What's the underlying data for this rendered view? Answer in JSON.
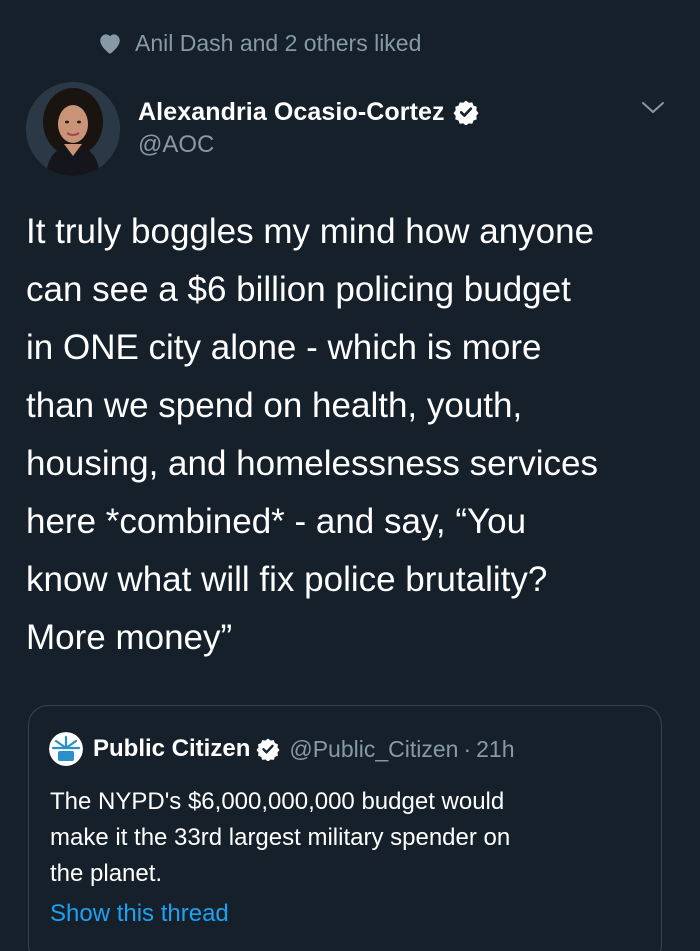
{
  "social_context": {
    "icon": "heart-icon",
    "text": "Anil Dash and 2 others liked"
  },
  "tweet": {
    "author_name": "Alexandria Ocasio-Cortez",
    "author_handle": "@AOC",
    "verified_icon": "verified-badge-icon",
    "menu_icon": "chevron-down-icon",
    "text": "It truly boggles my mind how anyone\ncan see a $6 billion policing budget\nin ONE city alone - which is more\nthan we spend on health, youth,\nhousing, and homelessness services\nhere *combined* - and say, “You\nknow what will fix police brutality?\nMore money”"
  },
  "quoted_tweet": {
    "author_name": "Public Citizen",
    "author_handle": "@Public_Citizen",
    "separator": "·",
    "time": "21h",
    "text": "The NYPD's $6,000,000,000 budget would\nmake it the 33rd largest military spender on\nthe planet.",
    "link_label": "Show this thread"
  },
  "colors": {
    "background": "#15202b",
    "text_primary": "#ffffff",
    "text_secondary": "#8899a6",
    "accent": "#1da1f2",
    "border": "#38444d"
  }
}
